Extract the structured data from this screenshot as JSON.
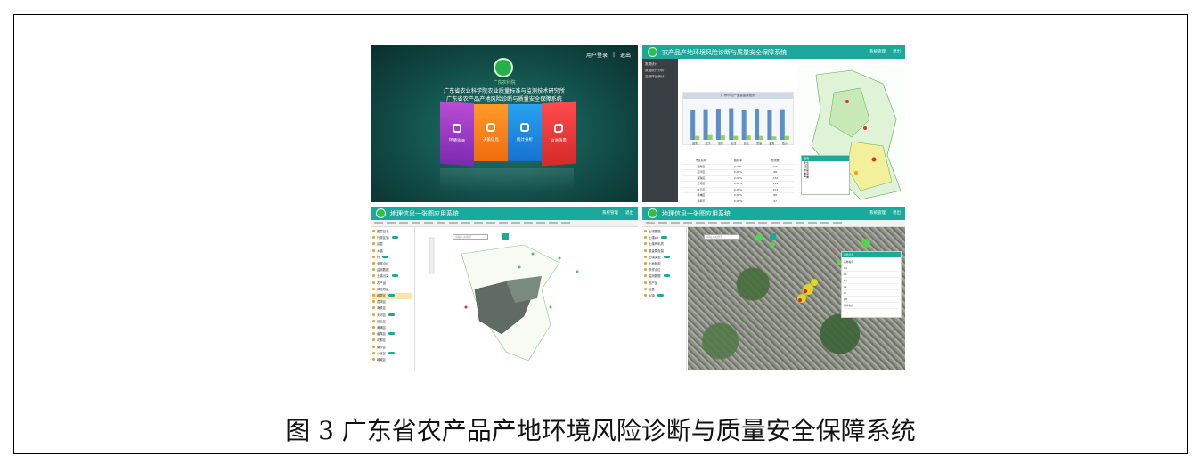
{
  "caption": "图 3 广东省农产品产地环境风险诊断与质量安全保障系统",
  "panel1": {
    "user_login": "用户登录",
    "logout": "退出",
    "logo_text": "广东农科院",
    "org_line1": "广东省农业科学院农业质量标准与监测技术研究所",
    "org_line2": "广东省农产品产地风险诊断与质量安全保障系统",
    "tiles": [
      {
        "label": "环境监测",
        "color": "#a63fcf"
      },
      {
        "label": "决策信息",
        "color": "#f5841a"
      },
      {
        "label": "统计分析",
        "color": "#1f8be0"
      },
      {
        "label": "监测信息",
        "color": "#e63535"
      }
    ]
  },
  "panel2": {
    "title": "农产品产地环境风险诊断与质量安全保障系统",
    "header_right": [
      "系统管理",
      "退出"
    ],
    "sidebar": [
      "数据统计",
      "数据统计分析",
      "监测样品统计"
    ],
    "chart_title": "广州市农产品重金属检测",
    "legend_title": "图例",
    "legend_items": [
      "安全",
      "轻度",
      "中度",
      "重度",
      "严重"
    ],
    "table_rows": [
      [
        "市区名称",
        "超标率",
        "检测数"
      ],
      [
        "越秀区",
        "0.00%",
        "115"
      ],
      [
        "荔湾区",
        "0.00%",
        "98"
      ],
      [
        "海珠区",
        "0.00%",
        "132"
      ],
      [
        "天河区",
        "0.00%",
        "149"
      ],
      [
        "白云区",
        "0.00%",
        "153"
      ],
      [
        "黄埔区",
        "0.00%",
        "88"
      ],
      [
        "番禺区",
        "0.00%",
        "97"
      ],
      [
        "南沙区",
        "0.00%",
        "103"
      ]
    ]
  },
  "panel3": {
    "title": "地理信息一张图应用系统",
    "header_right": [
      "系统管理",
      "退出"
    ],
    "search_placeholder": "请输入关键字",
    "tree": [
      "图层目录",
      "行政区划",
      "区县",
      "乡镇",
      "村",
      "采样点位",
      "监测数据",
      "土壤污染",
      "农产品",
      "风险等级",
      "越秀区",
      "荔湾区",
      "海珠区",
      "天河区",
      "白云区",
      "黄埔区",
      "番禺区",
      "花都区",
      "南沙区",
      "从化区",
      "增城区"
    ],
    "selected_index": 10
  },
  "panel4": {
    "title": "地理信息一张图应用系统",
    "header_right": [
      "系统管理",
      "退出"
    ],
    "search_placeholder": "请输入关键字",
    "tree": [
      "土壤数据",
      "土壤pH",
      "土壤有机质",
      "重金属含量",
      "土壤类型",
      "土地利用",
      "采样点位",
      "监测数据",
      "农产品",
      "区县",
      "乡镇"
    ],
    "info_title": "属性信息",
    "info_rows": [
      "采样编号",
      "Cd",
      "Pb",
      "Hg",
      "As",
      "Cr",
      "pH",
      "采样地点"
    ]
  },
  "chart_data": {
    "type": "bar",
    "categories": [
      "越秀",
      "荔湾",
      "海珠",
      "天河",
      "白云",
      "黄埔",
      "番禺",
      "南沙"
    ],
    "series": [
      {
        "values": [
          62,
          64,
          65,
          66,
          63,
          65,
          62,
          64
        ],
        "color": "#5b8fc7"
      },
      {
        "values": [
          8,
          10,
          9,
          8,
          9,
          8,
          7,
          8
        ],
        "color": "#9ccf5a"
      }
    ],
    "ylim": [
      0,
      80
    ]
  },
  "colors": {
    "header": "#1aa99a",
    "selected": "#fbe7a5"
  }
}
